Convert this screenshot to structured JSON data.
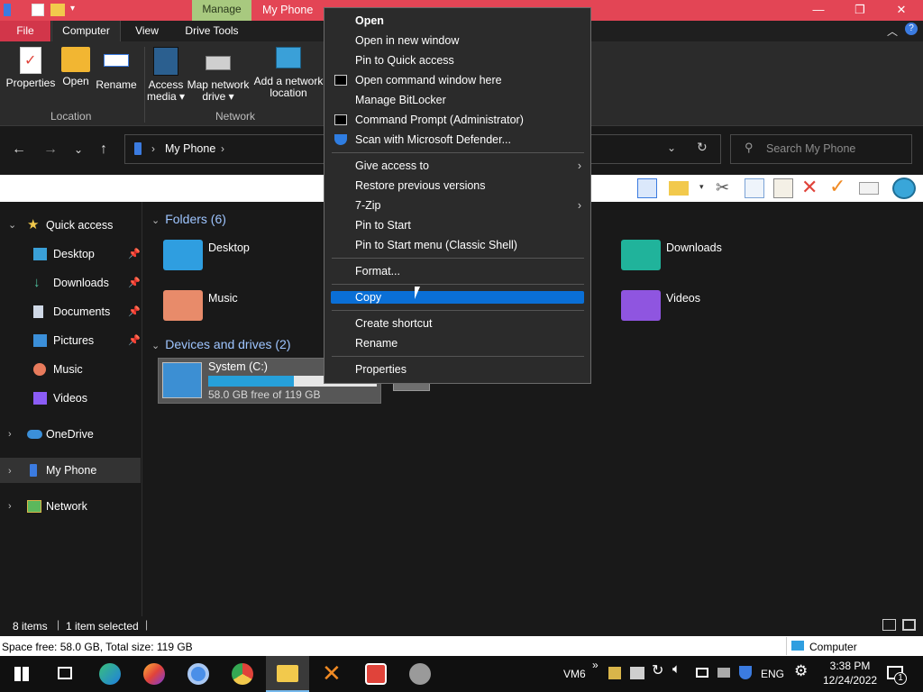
{
  "window": {
    "manage_tab": "Manage",
    "title": "My Phone",
    "controls": {
      "minimize": "—",
      "maximize": "❐",
      "close": "✕"
    }
  },
  "ribbon": {
    "tabs": [
      "File",
      "Computer",
      "View",
      "Drive Tools"
    ],
    "buttons": {
      "properties": "Properties",
      "open": "Open",
      "rename": "Rename",
      "access_media": "Access media ▾",
      "map_network_drive": "Map network drive ▾",
      "add_network_location": "Add a network location"
    },
    "groups": {
      "location": "Location",
      "network": "Network"
    }
  },
  "address": {
    "path": "My Phone",
    "search_placeholder": "Search My Phone"
  },
  "nav": {
    "quick_access": "Quick access",
    "items": [
      {
        "label": "Desktop",
        "pinned": true
      },
      {
        "label": "Downloads",
        "pinned": true
      },
      {
        "label": "Documents",
        "pinned": true
      },
      {
        "label": "Pictures",
        "pinned": true
      },
      {
        "label": "Music",
        "pinned": false
      },
      {
        "label": "Videos",
        "pinned": false
      }
    ],
    "onedrive": "OneDrive",
    "my_phone": "My Phone",
    "network": "Network"
  },
  "content": {
    "folders_header": "Folders (6)",
    "folders": {
      "desktop": "Desktop",
      "music": "Music",
      "downloads": "Downloads",
      "videos": "Videos"
    },
    "devices_header": "Devices and drives (2)",
    "drive": {
      "name": "System (C:)",
      "free_text": "58.0 GB free of 119 GB",
      "used_fraction": 0.51
    }
  },
  "context_menu": {
    "items": [
      {
        "label": "Open",
        "bold": true
      },
      {
        "label": "Open in new window"
      },
      {
        "label": "Pin to Quick access"
      },
      {
        "label": "Open command window here"
      },
      {
        "label": "Manage BitLocker"
      },
      {
        "label": "Command Prompt (Administrator)"
      },
      {
        "label": "Scan with Microsoft Defender..."
      },
      {
        "label": "Give access to",
        "submenu": true
      },
      {
        "label": "Restore previous versions"
      },
      {
        "label": "7-Zip",
        "submenu": true
      },
      {
        "label": "Pin to Start"
      },
      {
        "label": "Pin to Start menu (Classic Shell)"
      },
      {
        "label": "Format..."
      },
      {
        "label": "Copy",
        "highlighted": true
      },
      {
        "label": "Create shortcut"
      },
      {
        "label": "Rename"
      },
      {
        "label": "Properties"
      }
    ]
  },
  "status": {
    "items_count": "8 items",
    "selected": "1 item selected",
    "space": "Space free: 58.0 GB, Total size: 119 GB",
    "computer": "Computer"
  },
  "taskbar": {
    "vm_label": "VM6",
    "chevron": "»",
    "lang": "ENG",
    "time": "3:38 PM",
    "date": "12/24/2022",
    "notif_count": "1"
  },
  "colors": {
    "title_bar": "#e34555",
    "manage_tab": "#a8c97f",
    "file_tab": "#d2364a",
    "accent_blue": "#0a6fd6",
    "drive_bar": "#26a0da",
    "section_header": "#9ec5ff"
  }
}
